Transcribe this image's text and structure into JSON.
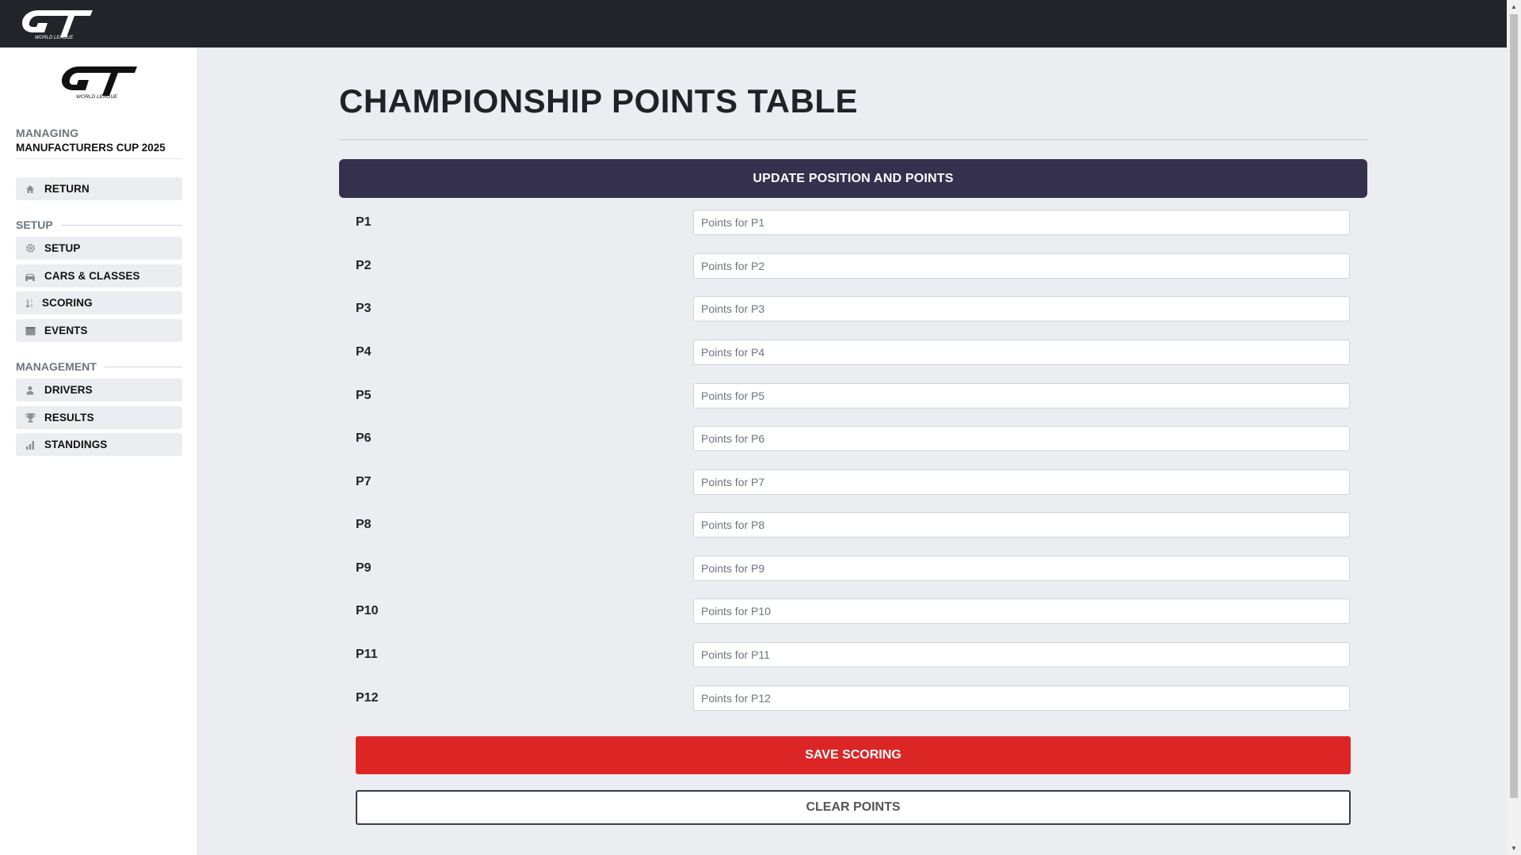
{
  "brand": {
    "logo_alt": "GT World League"
  },
  "sidebar": {
    "managing_label": "MANAGING",
    "managing_name": "MANUFACTURERS CUP 2025",
    "return_label": "RETURN",
    "sections": [
      {
        "title": "SETUP",
        "items": [
          {
            "label": "SETUP",
            "icon": "gear-icon"
          },
          {
            "label": "CARS & CLASSES",
            "icon": "car-icon"
          },
          {
            "label": "SCORING",
            "icon": "sort-icon"
          },
          {
            "label": "EVENTS",
            "icon": "calendar-icon"
          }
        ]
      },
      {
        "title": "MANAGEMENT",
        "items": [
          {
            "label": "DRIVERS",
            "icon": "user-icon"
          },
          {
            "label": "RESULTS",
            "icon": "trophy-icon"
          },
          {
            "label": "STANDINGS",
            "icon": "bar-chart-icon"
          }
        ]
      }
    ]
  },
  "main": {
    "title": "CHAMPIONSHIP POINTS TABLE",
    "card_header": "UPDATE POSITION AND POINTS",
    "rows": [
      {
        "position": "P1",
        "placeholder": "Points for P1",
        "value": ""
      },
      {
        "position": "P2",
        "placeholder": "Points for P2",
        "value": ""
      },
      {
        "position": "P3",
        "placeholder": "Points for P3",
        "value": ""
      },
      {
        "position": "P4",
        "placeholder": "Points for P4",
        "value": ""
      },
      {
        "position": "P5",
        "placeholder": "Points for P5",
        "value": ""
      },
      {
        "position": "P6",
        "placeholder": "Points for P6",
        "value": ""
      },
      {
        "position": "P7",
        "placeholder": "Points for P7",
        "value": ""
      },
      {
        "position": "P8",
        "placeholder": "Points for P8",
        "value": ""
      },
      {
        "position": "P9",
        "placeholder": "Points for P9",
        "value": ""
      },
      {
        "position": "P10",
        "placeholder": "Points for P10",
        "value": ""
      },
      {
        "position": "P11",
        "placeholder": "Points for P11",
        "value": ""
      },
      {
        "position": "P12",
        "placeholder": "Points for P12",
        "value": ""
      }
    ],
    "save_label": "SAVE SCORING",
    "clear_label": "CLEAR POINTS"
  },
  "colors": {
    "topbar": "#212529",
    "card_header": "#34304d",
    "save_button": "#dc2626",
    "page_background": "#ebedf0"
  }
}
